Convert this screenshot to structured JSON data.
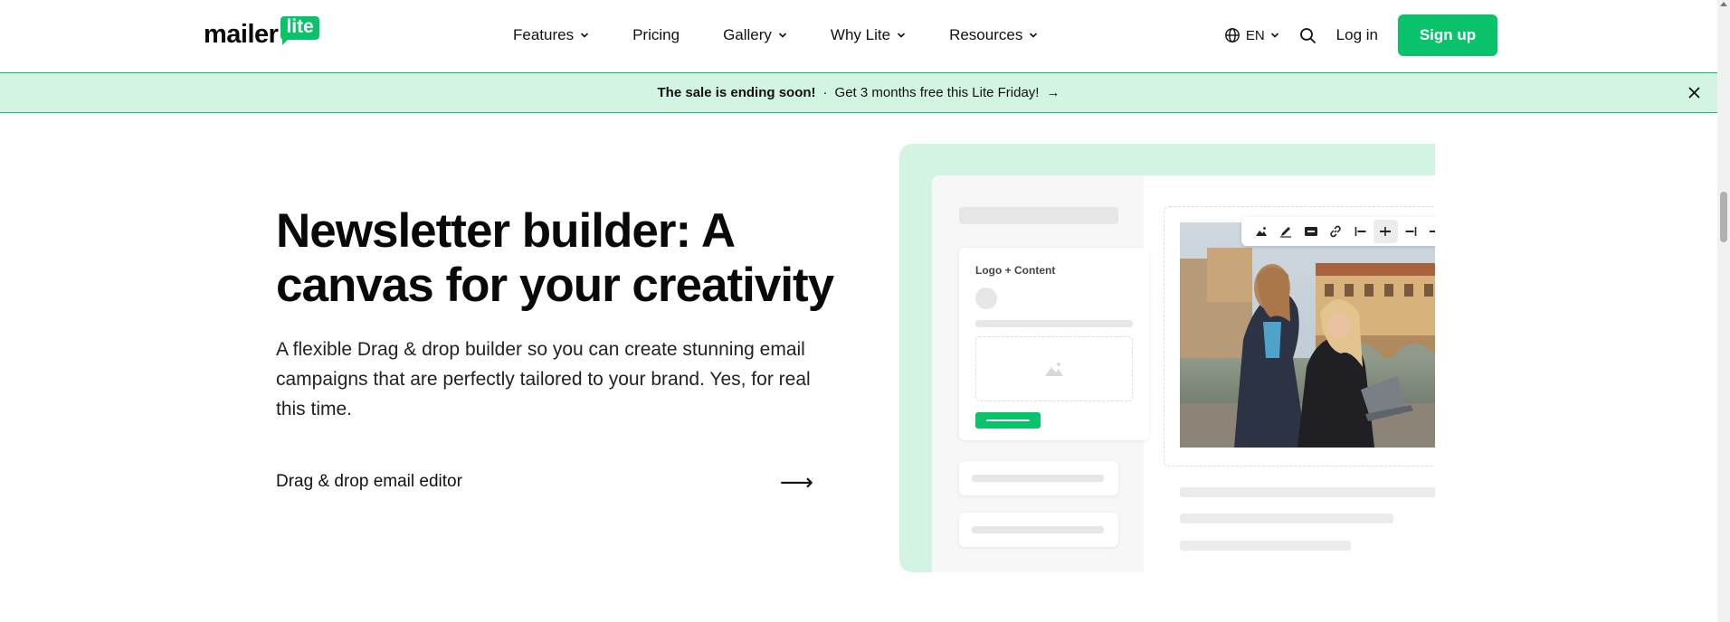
{
  "header": {
    "logo_word": "mailer",
    "logo_badge": "lite",
    "nav": [
      {
        "label": "Features",
        "dropdown": true
      },
      {
        "label": "Pricing",
        "dropdown": false
      },
      {
        "label": "Gallery",
        "dropdown": true
      },
      {
        "label": "Why Lite",
        "dropdown": true
      },
      {
        "label": "Resources",
        "dropdown": true
      }
    ],
    "language": "EN",
    "login_label": "Log in",
    "signup_label": "Sign up"
  },
  "banner": {
    "bold_text": "The sale is ending soon!",
    "separator": "·",
    "text": "Get 3 months free this Lite Friday!",
    "arrow": "→"
  },
  "hero": {
    "title": "Newsletter builder: A canvas for your creativity",
    "description": "A flexible Drag & drop builder so you can create stunning email campaigns that are perfectly tailored to your brand. Yes, for real this time.",
    "cta_label": "Drag & drop email editor",
    "cta_arrow": "⟶"
  },
  "illustration": {
    "card_label": "Logo + Content",
    "toolbar_icons": [
      "image-icon",
      "edit-icon",
      "alt-text-icon",
      "link-icon",
      "align-left-icon",
      "align-center-icon",
      "align-right-icon",
      "full-width-icon"
    ],
    "active_tool": "align-center-icon"
  },
  "colors": {
    "brand_green": "#09c269",
    "banner_bg": "#d3f4e3",
    "text": "#111111"
  }
}
